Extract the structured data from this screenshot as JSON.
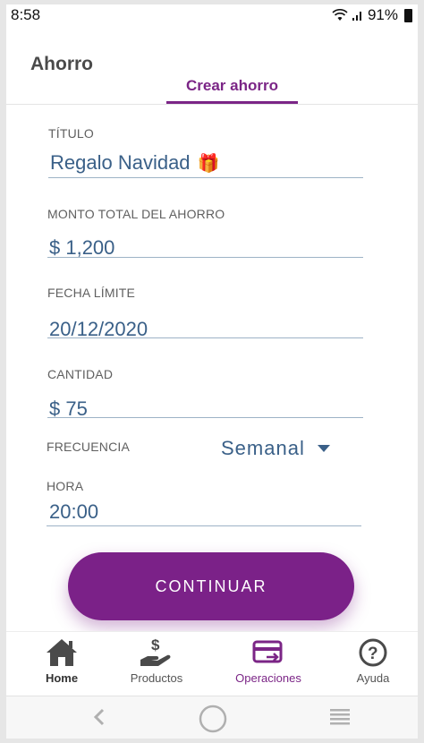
{
  "status_bar": {
    "time": "8:58",
    "battery": "91%"
  },
  "header": {
    "title": "Ahorro",
    "tab_label": "Crear ahorro"
  },
  "form": {
    "title_label": "TÍTULO",
    "title_value": "Regalo Navidad",
    "title_emoji": "🎁",
    "total_label": "MONTO TOTAL DEL AHORRO",
    "total_value": "$ 1,200",
    "date_label": "FECHA LÍMITE",
    "date_value": "20/12/2020",
    "amount_label": "CANTIDAD",
    "amount_value": "$ 75",
    "frequency_label": "FRECUENCIA",
    "frequency_value": "Semanal",
    "time_label": "HORA",
    "time_value": "20:00"
  },
  "continue_label": "CONTINUAR",
  "bottom_nav": {
    "items": [
      {
        "label": "Home",
        "icon": "home-icon"
      },
      {
        "label": "Productos",
        "icon": "hand-money-icon"
      },
      {
        "label": "Operaciones",
        "icon": "card-transfer-icon",
        "active": true
      },
      {
        "label": "Ayuda",
        "icon": "help-icon"
      }
    ]
  },
  "colors": {
    "brand_purple": "#7b2188",
    "value_blue": "#3a6088",
    "label_gray": "#606060"
  }
}
